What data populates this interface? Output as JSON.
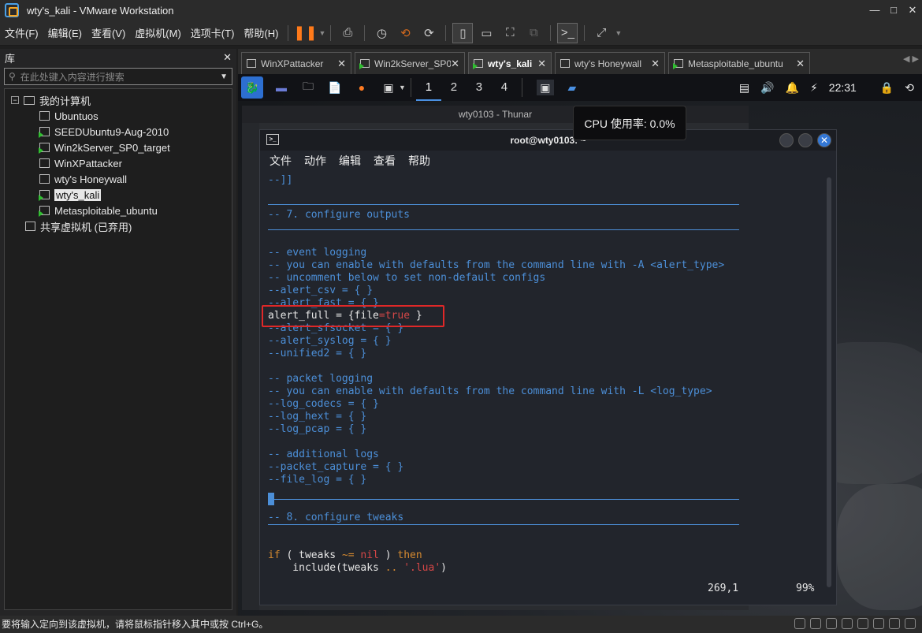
{
  "window": {
    "title": "wty's_kali - VMware Workstation",
    "controls": [
      "—",
      "□",
      "✕"
    ]
  },
  "menubar": {
    "items": [
      "文件(F)",
      "编辑(E)",
      "查看(V)",
      "虚拟机(M)",
      "选项卡(T)",
      "帮助(H)"
    ]
  },
  "library": {
    "title": "库",
    "close": "✕",
    "search_placeholder": "在此处键入内容进行搜索",
    "root": "我的计算机",
    "vms": [
      {
        "name": "Ubuntuos",
        "running": false
      },
      {
        "name": "SEEDUbuntu9-Aug-2010",
        "running": true
      },
      {
        "name": "Win2kServer_SP0_target",
        "running": true
      },
      {
        "name": "WinXPattacker",
        "running": false
      },
      {
        "name": "wty's Honeywall",
        "running": false
      },
      {
        "name": "wty's_kali",
        "running": true,
        "selected": true
      },
      {
        "name": "Metasploitable_ubuntu",
        "running": true
      }
    ],
    "shared": "共享虚拟机 (已弃用)"
  },
  "tabs": [
    {
      "label": "WinXPattacker",
      "running": false
    },
    {
      "label": "Win2kServer_SP0_target",
      "running": true
    },
    {
      "label": "wty's_kali",
      "running": true,
      "active": true
    },
    {
      "label": "wty's Honeywall",
      "running": false
    },
    {
      "label": "Metasploitable_ubuntu",
      "running": true
    }
  ],
  "kali_panel": {
    "workspaces": [
      "1",
      "2",
      "3",
      "4"
    ],
    "active_workspace": "1",
    "clock": "22:31"
  },
  "thunar": {
    "title": "wty0103 - Thunar"
  },
  "tooltip": {
    "text": "CPU 使用率: 0.0%"
  },
  "terminal": {
    "title": "root@wty0103: ~",
    "menu": [
      "文件",
      "动作",
      "编辑",
      "查看",
      "帮助"
    ],
    "status_pos": "269,1",
    "status_pct": "99%"
  },
  "statusbar": {
    "text": "要将输入定向到该虚拟机，请将鼠标指针移入其中或按 Ctrl+G。"
  }
}
